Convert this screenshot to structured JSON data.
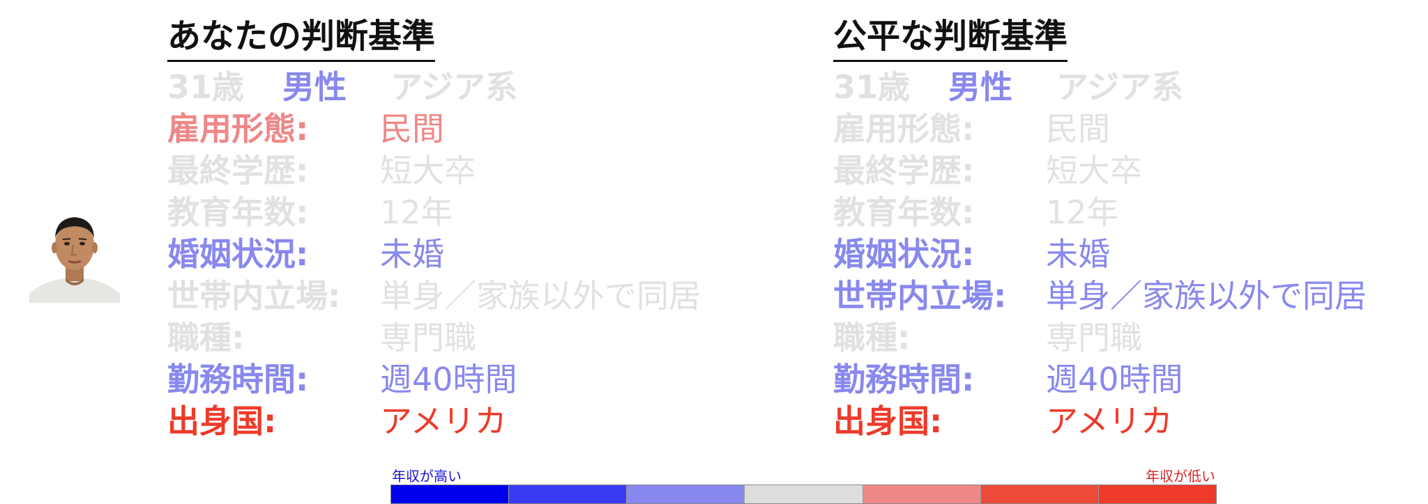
{
  "panels": [
    {
      "title": "あなたの判断基準",
      "demographics": {
        "age": "31歳",
        "gender": "男性",
        "ethnicity": "アジア系"
      },
      "attributes": [
        {
          "label": "雇用形態:",
          "value": "民間"
        },
        {
          "label": "最終学歴:",
          "value": "短大卒"
        },
        {
          "label": "教育年数:",
          "value": "12年"
        },
        {
          "label": "婚姻状況:",
          "value": "未婚"
        },
        {
          "label": "世帯内立場:",
          "value": "単身／家族以外で同居"
        },
        {
          "label": "職種:",
          "value": "専門職"
        },
        {
          "label": "勤務時間:",
          "value": "週40時間"
        },
        {
          "label": "出身国:",
          "value": "アメリカ"
        }
      ]
    },
    {
      "title": "公平な判断基準",
      "demographics": {
        "age": "31歳",
        "gender": "男性",
        "ethnicity": "アジア系"
      },
      "attributes": [
        {
          "label": "雇用形態:",
          "value": "民間"
        },
        {
          "label": "最終学歴:",
          "value": "短大卒"
        },
        {
          "label": "教育年数:",
          "value": "12年"
        },
        {
          "label": "婚姻状況:",
          "value": "未婚"
        },
        {
          "label": "世帯内立場:",
          "value": "単身／家族以外で同居"
        },
        {
          "label": "職種:",
          "value": "専門職"
        },
        {
          "label": "勤務時間:",
          "value": "週40時間"
        },
        {
          "label": "出身国:",
          "value": "アメリカ"
        }
      ]
    }
  ],
  "legend": {
    "high_label": "年収が高い",
    "low_label": "年収が低い",
    "colors": [
      "#0000ee",
      "#3a3af5",
      "#8888ee",
      "#dddddd",
      "#ee8888",
      "#ee4a3a",
      "#ee3a2a"
    ]
  },
  "colors": {
    "neutral": "#e1e1e1",
    "blue": "#8888ee",
    "red": "#ee3a2a",
    "light_red": "#ee8888"
  }
}
